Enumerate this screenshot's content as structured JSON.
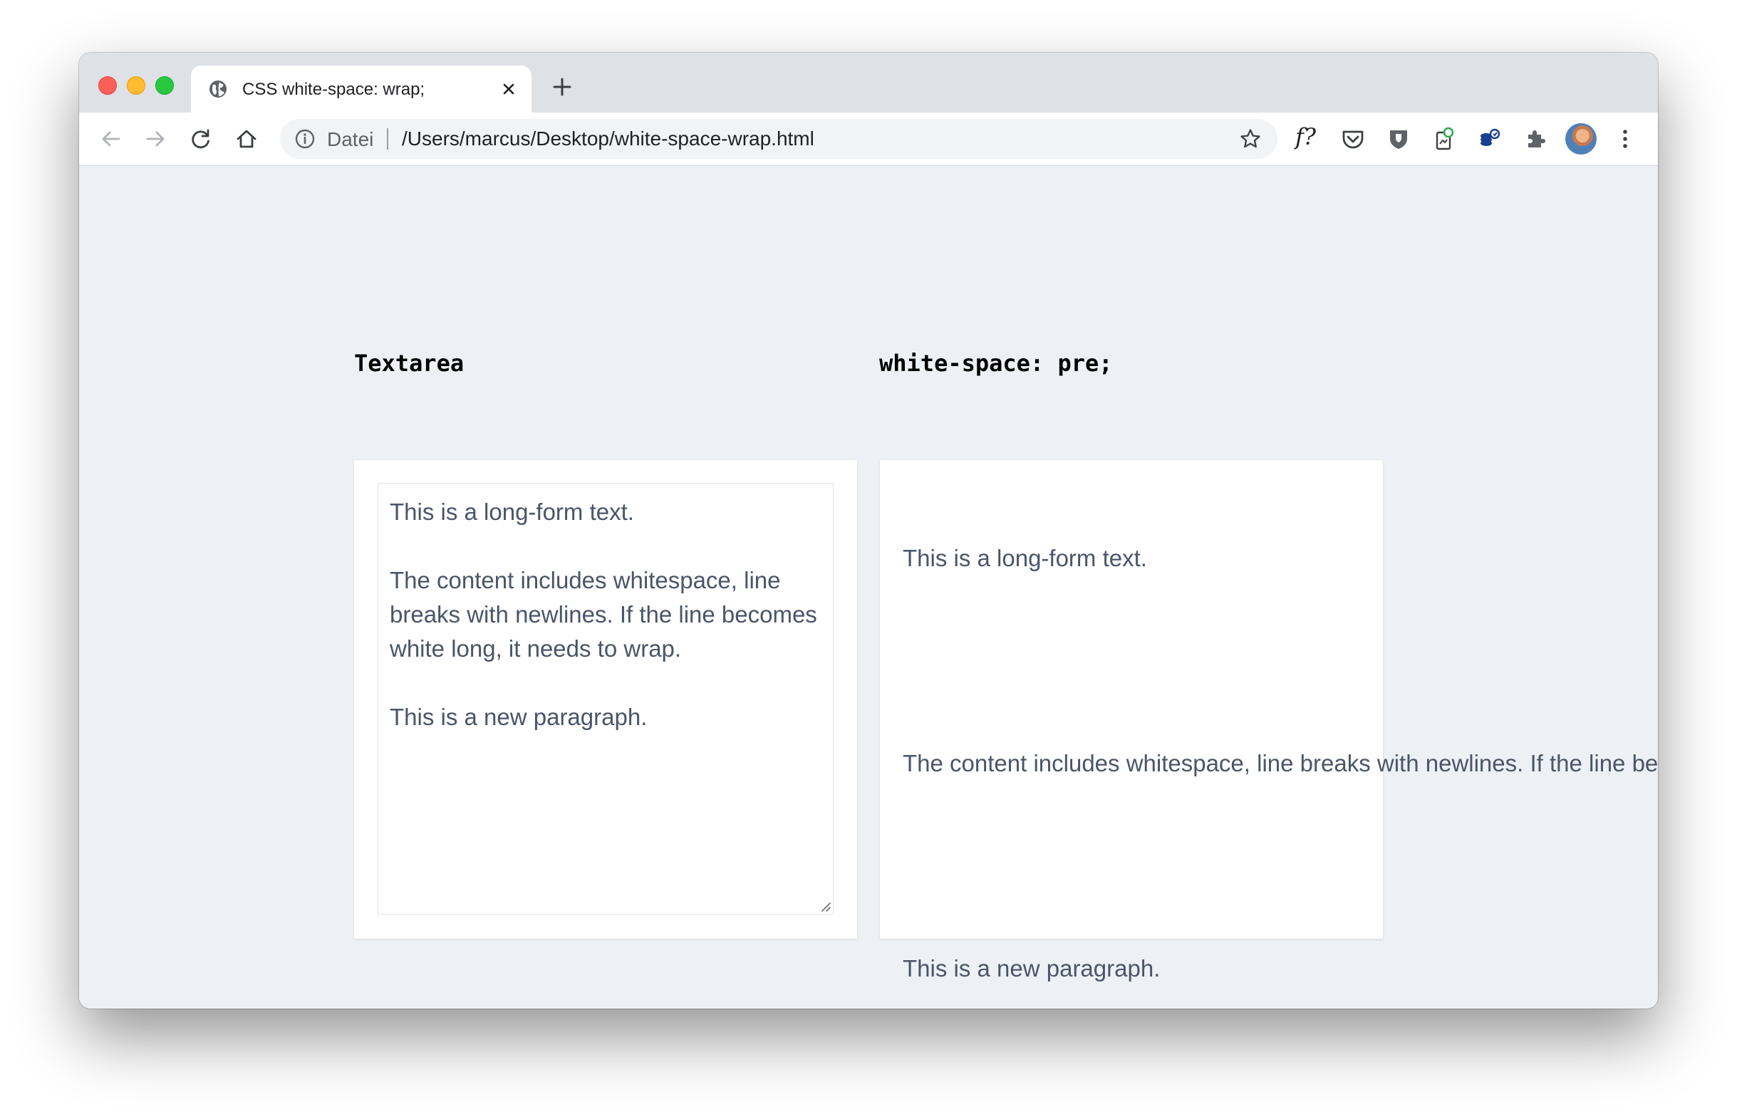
{
  "browser": {
    "tab": {
      "title": "CSS white-space: wrap;"
    },
    "address_bar": {
      "scheme_label": "Datei",
      "url": "/Users/marcus/Desktop/white-space-wrap.html"
    },
    "extensions": {
      "fx_label": "f?"
    },
    "icons": [
      "globe-icon",
      "close-icon",
      "plus-icon",
      "back-arrow-icon",
      "forward-arrow-icon",
      "reload-icon",
      "home-icon",
      "info-icon",
      "star-icon",
      "pocket-icon",
      "shield-extension-icon",
      "clipboard-extension-icon",
      "coins-extension-icon",
      "puzzle-icon",
      "avatar",
      "kebab-menu-icon"
    ],
    "colors": {
      "close": "#fe5f57",
      "minimize": "#febc2e",
      "maximize": "#28c840",
      "page_background": "#edf1f5",
      "text": "#4a5568"
    }
  },
  "page": {
    "left_heading": "Textarea",
    "right_heading": "white-space: pre;",
    "textarea": {
      "paragraphs": [
        "This is a long-form text.",
        "The content includes whitespace, line breaks with newlines. If the line becomes white long, it needs to wrap.",
        "This is a new paragraph."
      ]
    },
    "pre_box": {
      "paragraphs": [
        "This is a long-form text.",
        "The content includes whitespace, line breaks with newlines. If the line becomes white long, it needs to wrap.",
        "This is a new paragraph."
      ]
    }
  }
}
